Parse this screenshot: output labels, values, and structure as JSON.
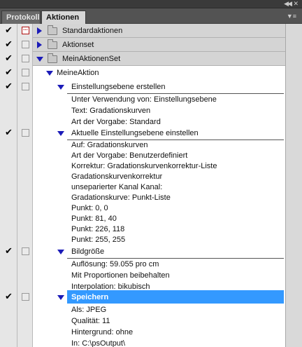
{
  "tabs": [
    {
      "label": "Protokoll",
      "active": false
    },
    {
      "label": "Aktionen",
      "active": true
    }
  ],
  "panel": {
    "collapse_icon": "double-chevron-left-icon",
    "close_icon": "close-x-icon",
    "menu_icon": "panel-menu-icon"
  },
  "sets": [
    {
      "label": "Standardaktionen",
      "expanded": false
    },
    {
      "label": "Aktionset",
      "expanded": false
    },
    {
      "label": "MeinAktionenSet",
      "expanded": true
    }
  ],
  "action": {
    "label": "MeineAktion",
    "expanded": true
  },
  "steps": [
    {
      "label": "Einstellungsebene erstellen",
      "details": [
        "Unter Verwendung von: Einstellungsebene",
        "Text: Gradationskurven",
        "Art der Vorgabe: Standard"
      ]
    },
    {
      "label": "Aktuelle Einstellungsebene einstellen",
      "details": [
        "Auf: Gradationskurven",
        "Art der Vorgabe: Benutzerdefiniert",
        "Korrektur: Gradationskurvenkorrektur-Liste",
        "Gradationskurvenkorrektur",
        "unseparierter Kanal Kanal:",
        "Gradationskurve: Punkt-Liste",
        "Punkt: 0, 0",
        "Punkt: 81, 40",
        "Punkt: 226, 118",
        "Punkt: 255, 255"
      ]
    },
    {
      "label": "Bildgröße",
      "details": [
        "Auflösung: 59.055 pro cm",
        "Mit Proportionen beibehalten",
        "Interpolation: bikubisch"
      ]
    },
    {
      "label": "Speichern",
      "selected": true,
      "details": [
        "Als: JPEG",
        "Qualität: 11",
        "Hintergrund: ohne",
        "In: C:\\psOutput\\"
      ]
    }
  ],
  "colors": {
    "selection": "#3399ff",
    "triangle": "#1b1bb8"
  }
}
